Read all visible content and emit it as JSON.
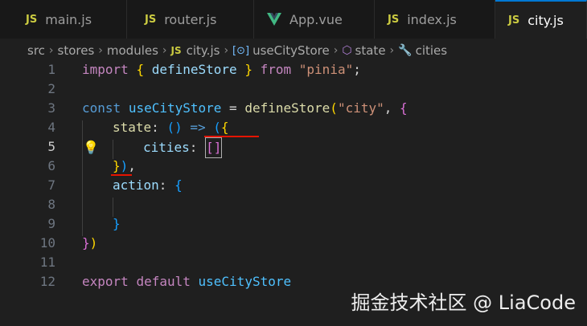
{
  "tabs": [
    {
      "icon": "JS",
      "label": "main.js"
    },
    {
      "icon": "JS",
      "label": "router.js"
    },
    {
      "icon": "vue-icon",
      "label": "App.vue"
    },
    {
      "icon": "JS",
      "label": "index.js"
    },
    {
      "icon": "JS",
      "label": "city.js",
      "active": true
    }
  ],
  "breadcrumb": {
    "items": [
      "src",
      "stores",
      "modules"
    ],
    "file_icon": "JS",
    "file": "city.js",
    "symbol1_icon": "[⊙]",
    "symbol1": "useCityStore",
    "symbol2": "state",
    "symbol3": "cities",
    "separator": "›"
  },
  "line_numbers": [
    "1",
    "2",
    "3",
    "4",
    "5",
    "6",
    "7",
    "8",
    "9",
    "10",
    "11",
    "12"
  ],
  "code": {
    "l1": {
      "import": "import",
      "ob": "{",
      "name": "defineStore",
      "cb": "}",
      "from": "from",
      "str": "\"pinia\"",
      "semi": ";"
    },
    "l3": {
      "const": "const",
      "name": "useCityStore",
      "eq": "=",
      "fn": "defineStore",
      "op": "(",
      "str": "\"city\"",
      "comma": ",",
      "ob": "{"
    },
    "l4": {
      "prop": "state",
      "colon": ":",
      "parens": "()",
      "arrow": "=>",
      "op": "(",
      "ob": "{"
    },
    "l5": {
      "prop": "cities",
      "colon": ":",
      "val": "[]"
    },
    "l6": {
      "cb": "}",
      "cp": ")",
      "comma": ","
    },
    "l7": {
      "prop": "action",
      "colon": ":",
      "ob": "{"
    },
    "l9": {
      "cb": "}"
    },
    "l10": {
      "cb": "}",
      "cp": ")"
    },
    "l12": {
      "export": "export",
      "default": "default",
      "name": "useCityStore"
    }
  },
  "watermark": "掘金技术社区 @ LiaCode",
  "colors": {
    "background": "#1f1f1f",
    "keyword": "#c586c0",
    "storage": "#569cd6",
    "function": "#dcdcaa",
    "string": "#ce9178",
    "property": "#9cdcfe",
    "squiggle": "#e51400",
    "js_icon": "#cbcb41"
  }
}
